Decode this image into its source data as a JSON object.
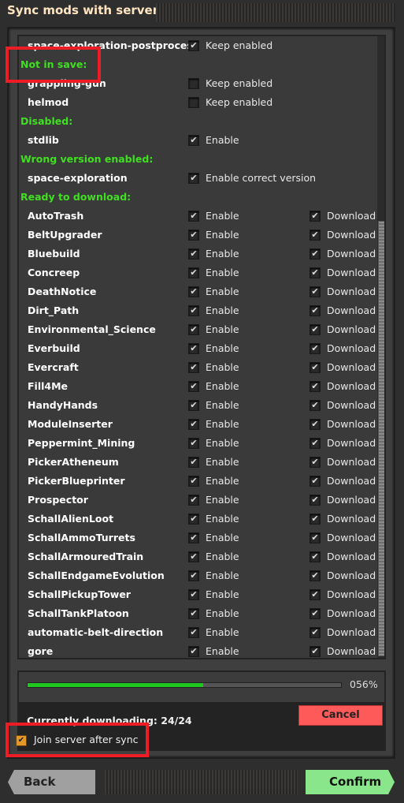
{
  "window": {
    "title": "Sync mods with server"
  },
  "sections": [
    {
      "type": "mod",
      "name": "space-exploration-postprocess",
      "checks": [
        {
          "checked": true,
          "label": "Keep enabled"
        }
      ]
    },
    {
      "type": "category",
      "label": "Not in save:"
    },
    {
      "type": "mod",
      "name": "grappling-gun",
      "checks": [
        {
          "checked": false,
          "label": "Keep enabled"
        }
      ]
    },
    {
      "type": "mod",
      "name": "helmod",
      "checks": [
        {
          "checked": false,
          "label": "Keep enabled"
        }
      ]
    },
    {
      "type": "category",
      "label": "Disabled:"
    },
    {
      "type": "mod",
      "name": "stdlib",
      "checks": [
        {
          "checked": true,
          "label": "Enable"
        }
      ]
    },
    {
      "type": "category",
      "label": "Wrong version enabled:"
    },
    {
      "type": "mod",
      "name": "space-exploration",
      "checks": [
        {
          "checked": true,
          "label": "Enable correct version"
        }
      ]
    },
    {
      "type": "category",
      "label": "Ready to download:"
    }
  ],
  "download_mods": [
    "AutoTrash",
    "BeltUpgrader",
    "Bluebuild",
    "Concreep",
    "DeathNotice",
    "Dirt_Path",
    "Environmental_Science",
    "Everbuild",
    "Evercraft",
    "Fill4Me",
    "HandyHands",
    "ModuleInserter",
    "Peppermint_Mining",
    "PickerAtheneum",
    "PickerBlueprinter",
    "Prospector",
    "SchallAlienLoot",
    "SchallAmmoTurrets",
    "SchallArmouredTrain",
    "SchallEndgameEvolution",
    "SchallPickupTower",
    "SchallTankPlatoon",
    "automatic-belt-direction",
    "gore"
  ],
  "download_labels": {
    "enable": "Enable",
    "download": "Download"
  },
  "progress": {
    "percent": 56,
    "percent_text": "056%",
    "status": "Currently downloading: 24/24",
    "cancel_label": "Cancel"
  },
  "join": {
    "label": "Join server after sync",
    "checked": true
  },
  "footer": {
    "back_label": "Back",
    "confirm_label": "Confirm"
  },
  "colors": {
    "category": "#3fe01f",
    "progress": "#1ec81e",
    "cancel": "#fe5a5a",
    "confirm": "#8ae68a",
    "highlight": "#ee1c25"
  }
}
